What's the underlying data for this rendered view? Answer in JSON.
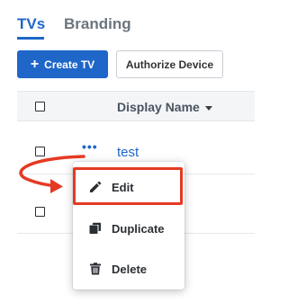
{
  "tabs": [
    {
      "label": "TVs",
      "active": true
    },
    {
      "label": "Branding",
      "active": false
    }
  ],
  "toolbar": {
    "create_label": "Create TV",
    "authorize_label": "Authorize Device"
  },
  "table": {
    "column_display_name": "Display Name",
    "rows": [
      {
        "display_name": "test",
        "actions": "•••"
      }
    ]
  },
  "context_menu": {
    "items": [
      {
        "label": "Edit",
        "icon": "pencil-icon"
      },
      {
        "label": "Duplicate",
        "icon": "copy-icon"
      },
      {
        "label": "Delete",
        "icon": "trash-icon"
      }
    ]
  },
  "colors": {
    "accent": "#1f66c9",
    "annotation": "#e53a24"
  }
}
